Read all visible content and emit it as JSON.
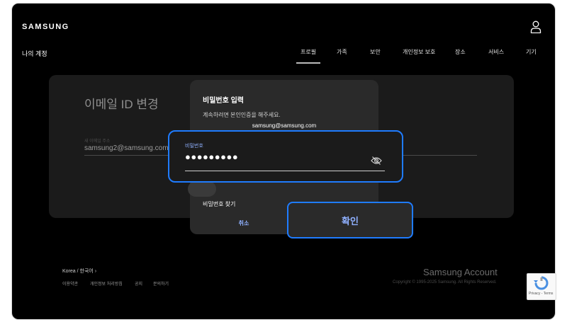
{
  "header": {
    "brand": "SAMSUNG",
    "user_icon": "user-icon"
  },
  "account": {
    "title": "나의 계정"
  },
  "nav": {
    "tabs": [
      {
        "label": "프로필",
        "active": true
      },
      {
        "label": "가족"
      },
      {
        "label": "보안"
      },
      {
        "label": "개인정보 보호"
      },
      {
        "label": "장소"
      },
      {
        "label": "서비스"
      },
      {
        "label": "기기"
      }
    ]
  },
  "card": {
    "title": "이메일 ID 변경",
    "field_label": "새 이메일 주소",
    "field_value": "samsung2@samsung.com"
  },
  "dialog": {
    "title": "비밀번호 입력",
    "description": "계속하려면 본인인증을 해주세요.",
    "email": "samsung@samsung.com",
    "find_password": "비밀번호 찾기",
    "cancel": "취소",
    "confirm": "확인"
  },
  "password": {
    "label": "비밀번호",
    "value": "●●●●●●●●●",
    "toggle_icon": "eye-off-icon"
  },
  "footer": {
    "region": "Korea / 한국어",
    "links": [
      "이용약관",
      "개인정보 처리방침",
      "공지",
      "문의하기"
    ],
    "brand": "Samsung Account",
    "copyright": "Copyright © 1995-2025 Samsung. All Rights Reserved."
  },
  "recaptcha": {
    "links": "Privacy - Terms"
  },
  "colors": {
    "accent": "#1f7cff",
    "accent_text": "#8fb0ff",
    "background": "#000000",
    "surface": "#1b1b1b",
    "dialog": "#2a2a2a"
  }
}
